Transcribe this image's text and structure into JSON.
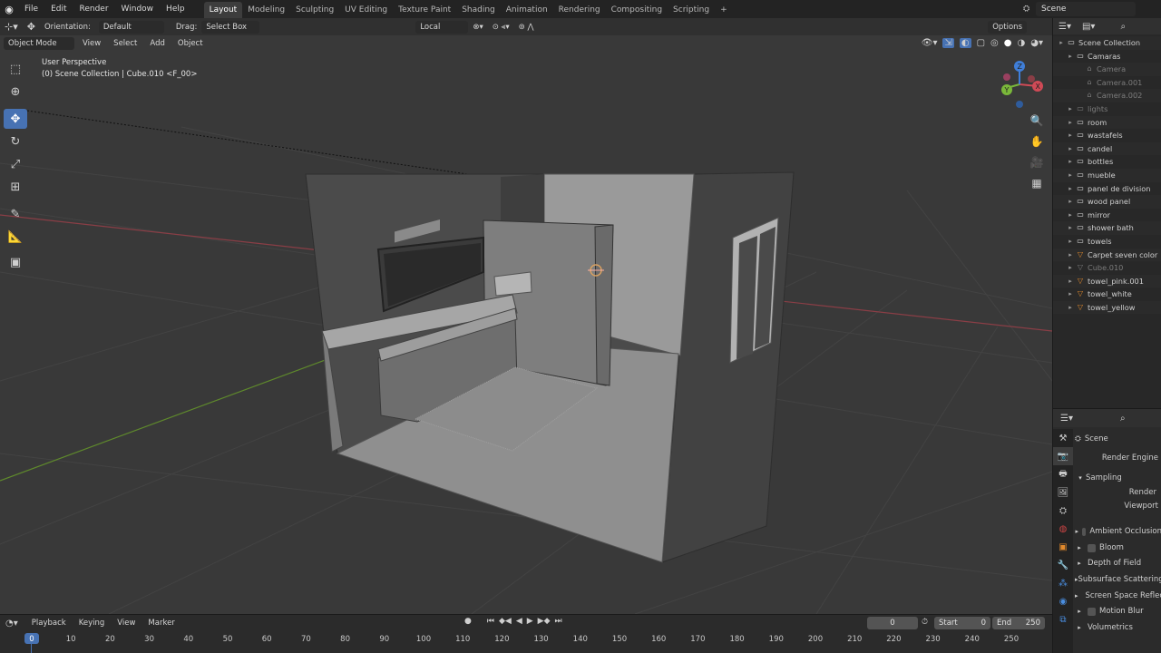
{
  "menubar": {
    "menus": [
      "File",
      "Edit",
      "Render",
      "Window",
      "Help"
    ],
    "workspaces": [
      "Layout",
      "Modeling",
      "Sculpting",
      "UV Editing",
      "Texture Paint",
      "Shading",
      "Animation",
      "Rendering",
      "Compositing",
      "Scripting",
      "+"
    ],
    "active_workspace": "Layout",
    "scene_name": "Scene"
  },
  "viewport": {
    "orientation_label": "Orientation:",
    "orientation_value": "Default",
    "drag_label": "Drag:",
    "drag_value": "Select Box",
    "transform_space": "Local",
    "options_label": "Options",
    "mode": "Object Mode",
    "menus": [
      "View",
      "Select",
      "Add",
      "Object"
    ],
    "overlay_title": "User Perspective",
    "overlay_subtitle": "(0) Scene Collection | Cube.010 <F_00>",
    "gizmo_axes": {
      "x": "X",
      "y": "Y",
      "z": "Z"
    },
    "colors": {
      "x_axis": "#d04a56",
      "y_axis": "#7ab83a",
      "z_axis": "#3f7ed8",
      "active_tool": "#4772b3"
    }
  },
  "outliner": {
    "rows": [
      {
        "name": "Scene Collection",
        "indent": 0,
        "icon": "collection-icon",
        "dim": false
      },
      {
        "name": "Camaras",
        "indent": 1,
        "icon": "collection-icon",
        "dim": false
      },
      {
        "name": "Camera",
        "indent": 2,
        "icon": "camera-icon",
        "dim": true
      },
      {
        "name": "Camera.001",
        "indent": 2,
        "icon": "camera-icon",
        "dim": true
      },
      {
        "name": "Camera.002",
        "indent": 2,
        "icon": "camera-icon",
        "dim": true
      },
      {
        "name": "lights",
        "indent": 1,
        "icon": "collection-icon",
        "dim": true
      },
      {
        "name": "room",
        "indent": 1,
        "icon": "collection-icon",
        "dim": false
      },
      {
        "name": "wastafels",
        "indent": 1,
        "icon": "collection-icon",
        "dim": false
      },
      {
        "name": "candel",
        "indent": 1,
        "icon": "collection-icon",
        "dim": false
      },
      {
        "name": "bottles",
        "indent": 1,
        "icon": "collection-icon",
        "dim": false
      },
      {
        "name": "mueble",
        "indent": 1,
        "icon": "collection-icon",
        "dim": false
      },
      {
        "name": "panel de division",
        "indent": 1,
        "icon": "collection-icon",
        "dim": false
      },
      {
        "name": "wood panel",
        "indent": 1,
        "icon": "collection-icon",
        "dim": false
      },
      {
        "name": "mirror",
        "indent": 1,
        "icon": "collection-icon",
        "dim": false
      },
      {
        "name": "shower bath",
        "indent": 1,
        "icon": "collection-icon",
        "dim": false
      },
      {
        "name": "towels",
        "indent": 1,
        "icon": "collection-icon",
        "dim": false
      },
      {
        "name": "Carpet seven color",
        "indent": 1,
        "icon": "mesh-icon",
        "dim": false
      },
      {
        "name": "Cube.010",
        "indent": 1,
        "icon": "mesh-icon",
        "dim": true
      },
      {
        "name": "towel_pink.001",
        "indent": 1,
        "icon": "mesh-icon",
        "dim": false
      },
      {
        "name": "towel_white",
        "indent": 1,
        "icon": "mesh-icon",
        "dim": false
      },
      {
        "name": "towel_yellow",
        "indent": 1,
        "icon": "mesh-icon",
        "dim": false
      }
    ]
  },
  "properties": {
    "context": "Scene",
    "render_engine_label": "Render Engine",
    "sampling_label": "Sampling",
    "render_label": "Render",
    "viewport_label": "Viewport",
    "sections": [
      {
        "label": "Ambient Occlusion",
        "checkbox": true
      },
      {
        "label": "Bloom",
        "checkbox": true
      },
      {
        "label": "Depth of Field",
        "checkbox": false
      },
      {
        "label": "Subsurface Scattering",
        "checkbox": false
      },
      {
        "label": "Screen Space Reflections",
        "checkbox": true
      },
      {
        "label": "Motion Blur",
        "checkbox": true
      },
      {
        "label": "Volumetrics",
        "checkbox": false
      }
    ]
  },
  "timeline": {
    "menus": [
      "Playback",
      "Keying",
      "View",
      "Marker"
    ],
    "current_frame": "0",
    "start_label": "Start",
    "start_value": "0",
    "end_label": "End",
    "end_value": "250",
    "ruler": [
      "0",
      "10",
      "20",
      "30",
      "40",
      "50",
      "60",
      "70",
      "80",
      "90",
      "100",
      "110",
      "120",
      "130",
      "140",
      "150",
      "160",
      "170",
      "180",
      "190",
      "200",
      "210",
      "220",
      "230",
      "240",
      "250"
    ]
  }
}
